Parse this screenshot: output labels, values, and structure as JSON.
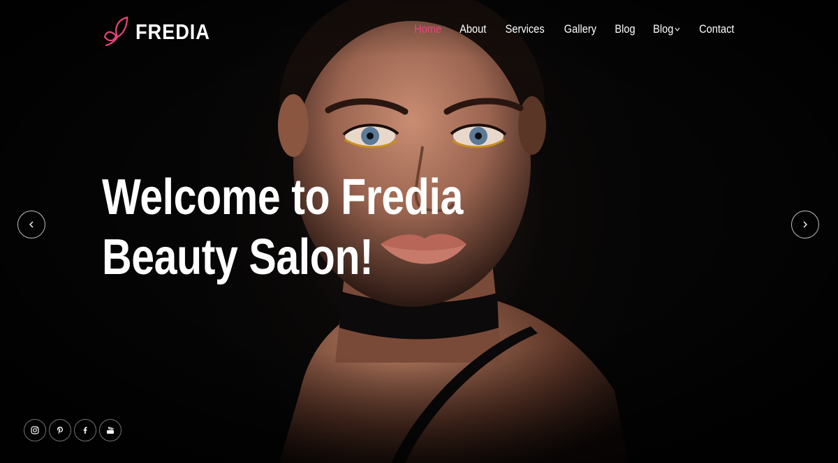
{
  "brand": {
    "name": "FREDIA",
    "accent_color": "#e8457f",
    "logo_icon": "butterfly-icon"
  },
  "nav": {
    "items": [
      {
        "label": "Home",
        "active": true
      },
      {
        "label": "About"
      },
      {
        "label": "Services"
      },
      {
        "label": "Gallery"
      },
      {
        "label": "Blog"
      },
      {
        "label": "Blog",
        "has_dropdown": true
      },
      {
        "label": "Contact"
      }
    ]
  },
  "hero": {
    "title_line1": "Welcome to Fredia",
    "title_line2": "Beauty Salon!",
    "image": "portrait-photo"
  },
  "slider": {
    "prev_icon": "chevron-left-icon",
    "next_icon": "chevron-right-icon"
  },
  "social": [
    {
      "icon": "instagram-icon"
    },
    {
      "icon": "pinterest-icon"
    },
    {
      "icon": "facebook-icon"
    },
    {
      "icon": "youtube-icon"
    }
  ]
}
